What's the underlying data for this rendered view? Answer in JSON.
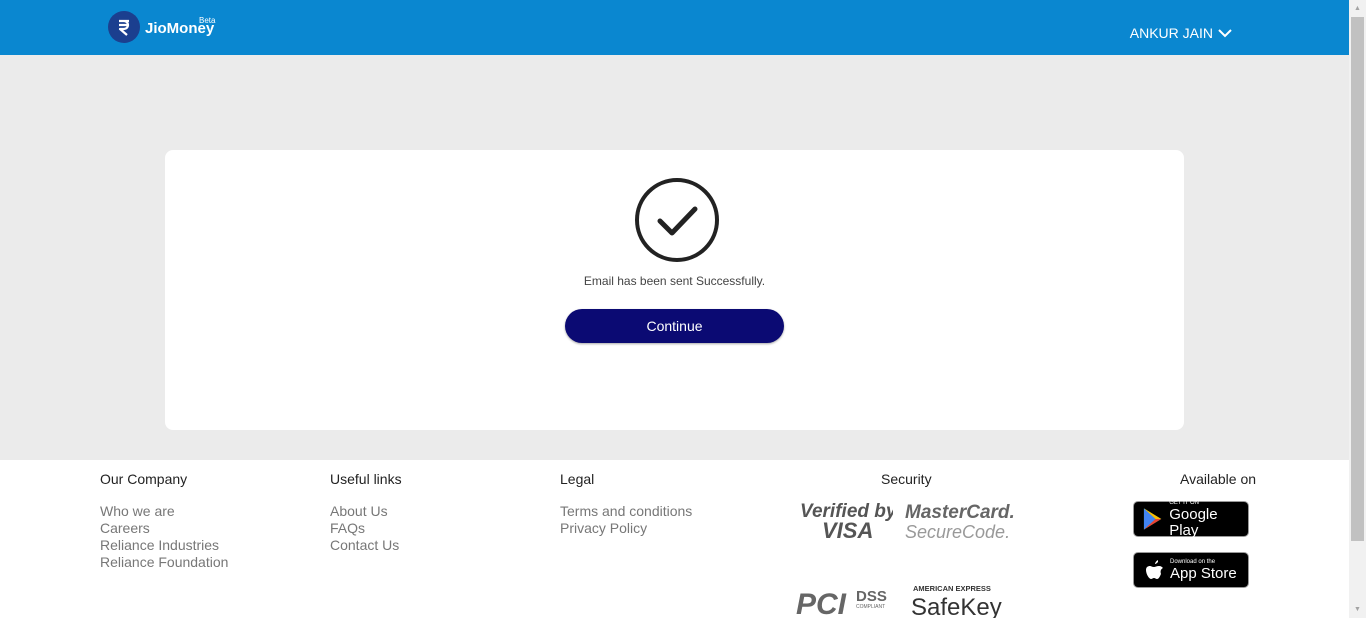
{
  "header": {
    "brand": "JioMoney",
    "beta": "Beta",
    "user_name": "ANKUR JAIN"
  },
  "card": {
    "message": "Email has been sent Successfully.",
    "continue_label": "Continue"
  },
  "footer": {
    "our_company": {
      "title": "Our Company",
      "links": [
        "Who we are",
        "Careers",
        "Reliance Industries",
        "Reliance Foundation"
      ]
    },
    "useful_links": {
      "title": "Useful links",
      "links": [
        "About Us",
        "FAQs",
        "Contact Us"
      ]
    },
    "legal": {
      "title": "Legal",
      "links": [
        "Terms and conditions",
        "Privacy Policy"
      ]
    },
    "security": {
      "title": "Security",
      "logos": {
        "visa_top": "Verified by",
        "visa_bottom": "VISA",
        "mc_top": "MasterCard.",
        "mc_bottom": "SecureCode.",
        "pci": "PCI",
        "dss": "DSS",
        "compliant": "COMPLIANT",
        "amex_top": "AMERICAN EXPRESS",
        "amex_bottom": "SafeKey"
      }
    },
    "available_on": {
      "title": "Available on",
      "google_small": "GET IT ON",
      "google_big": "Google Play",
      "apple_small": "Download on the",
      "apple_big": "App Store"
    }
  },
  "colors": {
    "header_bg": "#0a87d0",
    "button_bg": "#0b0a73",
    "page_bg": "#ebebeb"
  }
}
